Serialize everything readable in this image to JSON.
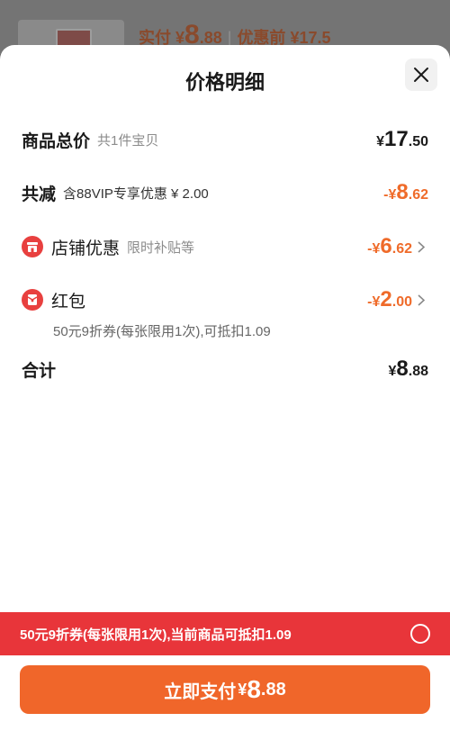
{
  "background": {
    "paid_label": "实付",
    "paid_currency": "¥",
    "paid_int": "8",
    "paid_dec": ".88",
    "before_discount": "优惠前 ¥17.5"
  },
  "sheet": {
    "title": "价格明细",
    "close_icon": "close-icon"
  },
  "rows": {
    "total": {
      "label": "商品总价",
      "sub": "共1件宝贝",
      "currency": "¥",
      "int": "17",
      "dec": ".50"
    },
    "discount": {
      "label": "共减",
      "sub": "含88VIP专享优惠 ¥ 2.00",
      "currency": "-¥",
      "int": "8",
      "dec": ".62"
    },
    "shop": {
      "label": "店铺优惠",
      "sub": "限时补贴等",
      "currency": "-¥",
      "int": "6",
      "dec": ".62",
      "icon": "shop-icon"
    },
    "redpacket": {
      "label": "红包",
      "note": "50元9折券(每张限用1次),可抵扣1.09",
      "currency": "-¥",
      "int": "2",
      "dec": ".00",
      "icon": "red-envelope-icon"
    },
    "sum": {
      "label": "合计",
      "currency": "¥",
      "int": "8",
      "dec": ".88"
    }
  },
  "coupon_bar": {
    "text": "50元9折券(每张限用1次),当前商品可抵扣1.09"
  },
  "pay_button": {
    "label": "立即支付",
    "currency": "¥",
    "int": "8",
    "dec": ".88"
  },
  "colors": {
    "accent_orange": "#ef6b2a",
    "coupon_red": "#e8353a",
    "button_orange": "#f0662a"
  }
}
